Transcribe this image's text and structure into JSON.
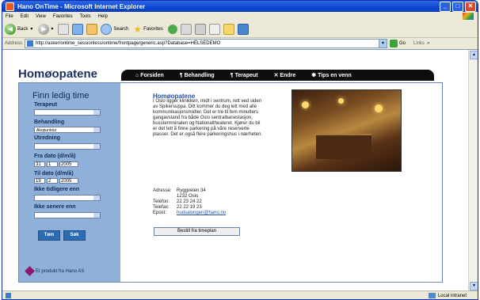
{
  "window": {
    "title": "Hano OnTime - Microsoft Internet Explorer",
    "min": "_",
    "max": "□",
    "close": "✕"
  },
  "menu": [
    "File",
    "Edit",
    "View",
    "Favorites",
    "Tools",
    "Help"
  ],
  "toolbar": {
    "back": "Back",
    "search": "Search",
    "favorites": "Favorites"
  },
  "address": {
    "label": "Address",
    "url": "http://asker/ontime_sessionless/ontime/frontpage/generic.asp?Database=HELSEDEMO",
    "go": "Go",
    "links": "Links"
  },
  "page": {
    "brand": "Homøopatene",
    "nav": [
      "Forsiden",
      "Behandling",
      "Terapeut",
      "Endre",
      "Tips en venn"
    ],
    "sidebar": {
      "heading": "Finn ledig time",
      "terapeut_label": "Terapeut",
      "terapeut_value": "",
      "behandling_label": "Behandling",
      "behandling_value": "Akupunktur",
      "utredning_label": "Utredning",
      "utredning_value": "",
      "fra_label": "Fra dato (d/m/å)",
      "fra_d": "31",
      "fra_m": "1",
      "fra_y": "2005",
      "til_label": "Til dato (d/m/å)",
      "til_d": "19",
      "til_m": "2",
      "til_y": "2005",
      "tidligere_label": "Ikke tidligere enn",
      "senere_label": "Ikke senere enn",
      "tom_button": "Tøm",
      "sok_button": "Søk",
      "produkt": "Et produkt fra Hano AS"
    },
    "main": {
      "title": "Homøopatene",
      "description": "I Oslo ligger klinikken, midt i sentrum, rett ved siden av Spikersuppa. Ditt kommer du deg lett med alle kommunikasjonsmidler. Det er tre til fem minutters gangavstand fra både Oslo sentralbanestasjon, busstermninalen og Nationaltheateret. Kjører du bil er det lett å finne parkering på våre reserverte plasser. Det er også flere parkeringshus i nærheten.",
      "contact": {
        "adresse_label": "Adresse:",
        "adresse_line1": "Ryggveien 34",
        "adresse_line2": "1232 Oslo",
        "telefon_label": "Telefon:",
        "telefon": "22 23 24 22",
        "telefax_label": "Telefax:",
        "telefax": "22 22 19 23",
        "epost_label": "Epost:",
        "epost": "hudsalongen@hano.no"
      },
      "bestill_button": "Bestill fra timeplan"
    }
  },
  "status": {
    "zone": "Local intranet"
  }
}
